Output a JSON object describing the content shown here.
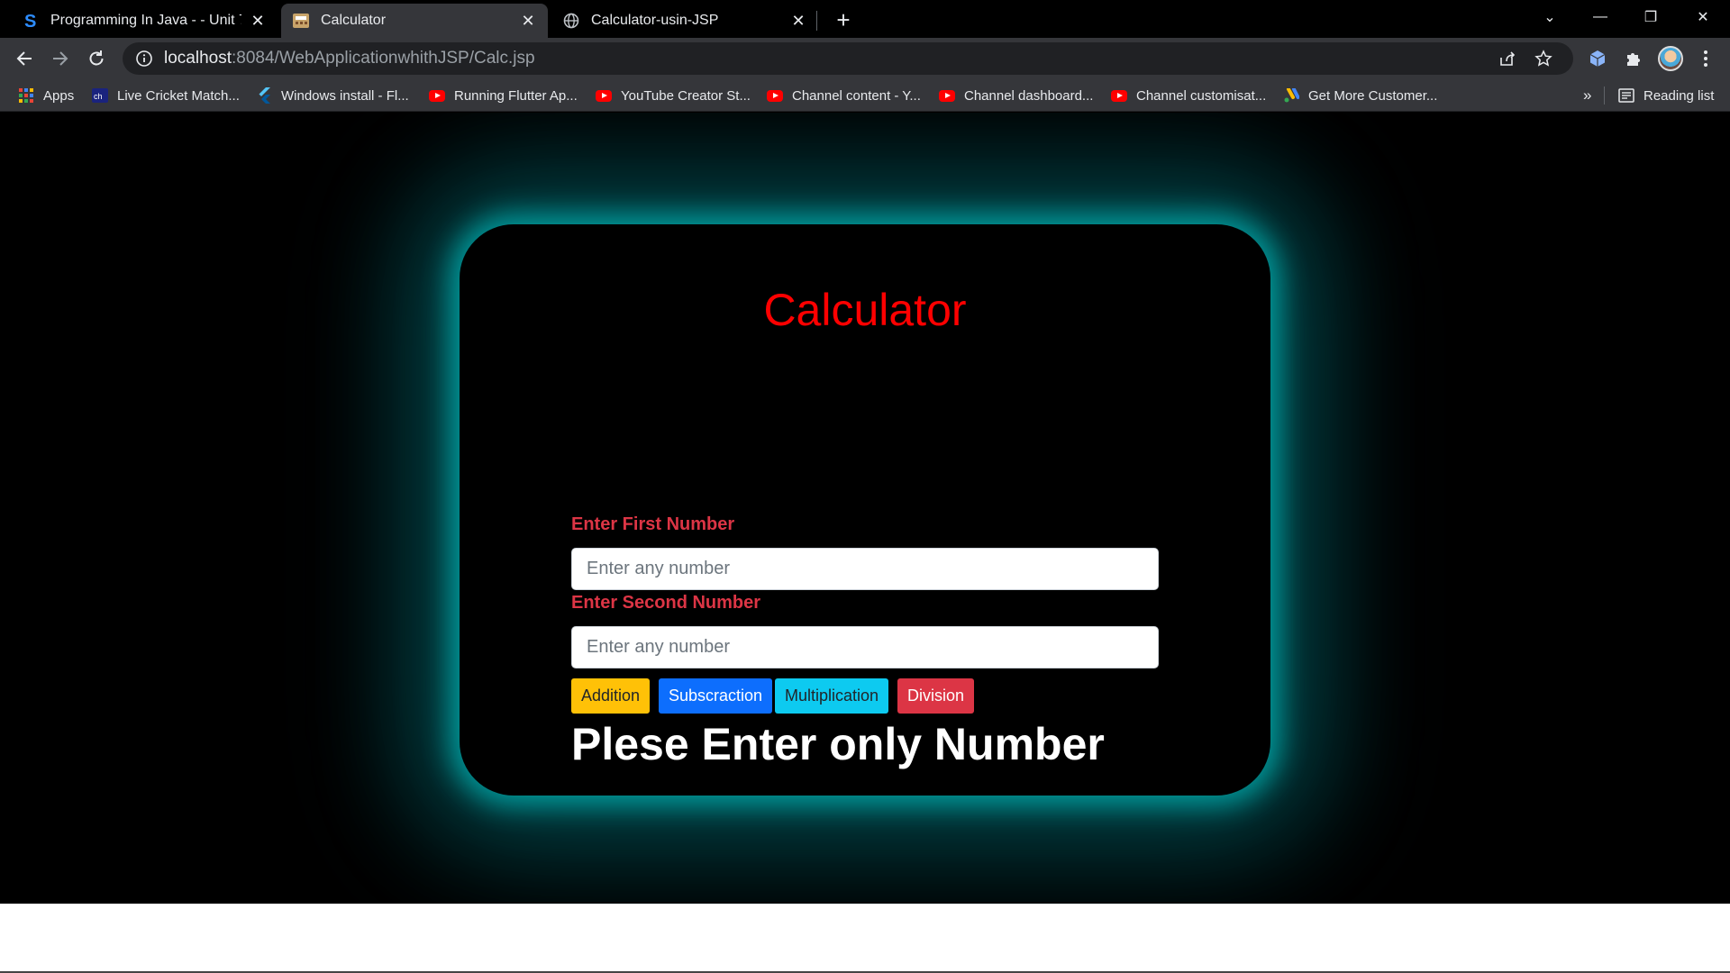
{
  "browser": {
    "tabs": [
      {
        "title": "Programming In Java - - Unit 7 -",
        "favicon": "s-logo-icon",
        "close": "✕"
      },
      {
        "title": "Calculator",
        "favicon": "calculator-favicon-icon",
        "close": "✕"
      },
      {
        "title": "Calculator-usin-JSP",
        "favicon": "globe-icon",
        "close": "✕"
      }
    ],
    "new_tab": "+",
    "window_controls": {
      "tab_search": "⌄",
      "minimize": "—",
      "restore": "❐",
      "close": "✕"
    },
    "address": {
      "host": "localhost",
      "path": ":8084/WebApplicationwhithJSP/Calc.jsp"
    },
    "bookmarks": [
      {
        "label": "Apps",
        "icon": "apps-grid-icon"
      },
      {
        "label": "Live Cricket Match...",
        "icon": "cricket-icon"
      },
      {
        "label": "Windows install - Fl...",
        "icon": "flutter-icon"
      },
      {
        "label": "Running Flutter Ap...",
        "icon": "youtube-icon"
      },
      {
        "label": "YouTube Creator St...",
        "icon": "youtube-icon"
      },
      {
        "label": "Channel content - Y...",
        "icon": "youtube-icon"
      },
      {
        "label": "Channel dashboard...",
        "icon": "youtube-icon"
      },
      {
        "label": "Channel customisat...",
        "icon": "youtube-icon"
      },
      {
        "label": "Get More Customer...",
        "icon": "google-ads-icon"
      }
    ],
    "more_bookmarks": "»",
    "reading_list": "Reading list"
  },
  "page": {
    "title": "Calculator",
    "first_label": "Enter First Number",
    "second_label": "Enter Second Number",
    "placeholder": "Enter any number",
    "buttons": {
      "addition": "Addition",
      "subtraction": "Subscraction",
      "multiplication": "Multiplication",
      "division": "Division"
    },
    "result": "Plese Enter only Number",
    "colors": {
      "title": "#ff0000",
      "label": "#dc3545",
      "glow": "#00c8c8"
    }
  }
}
